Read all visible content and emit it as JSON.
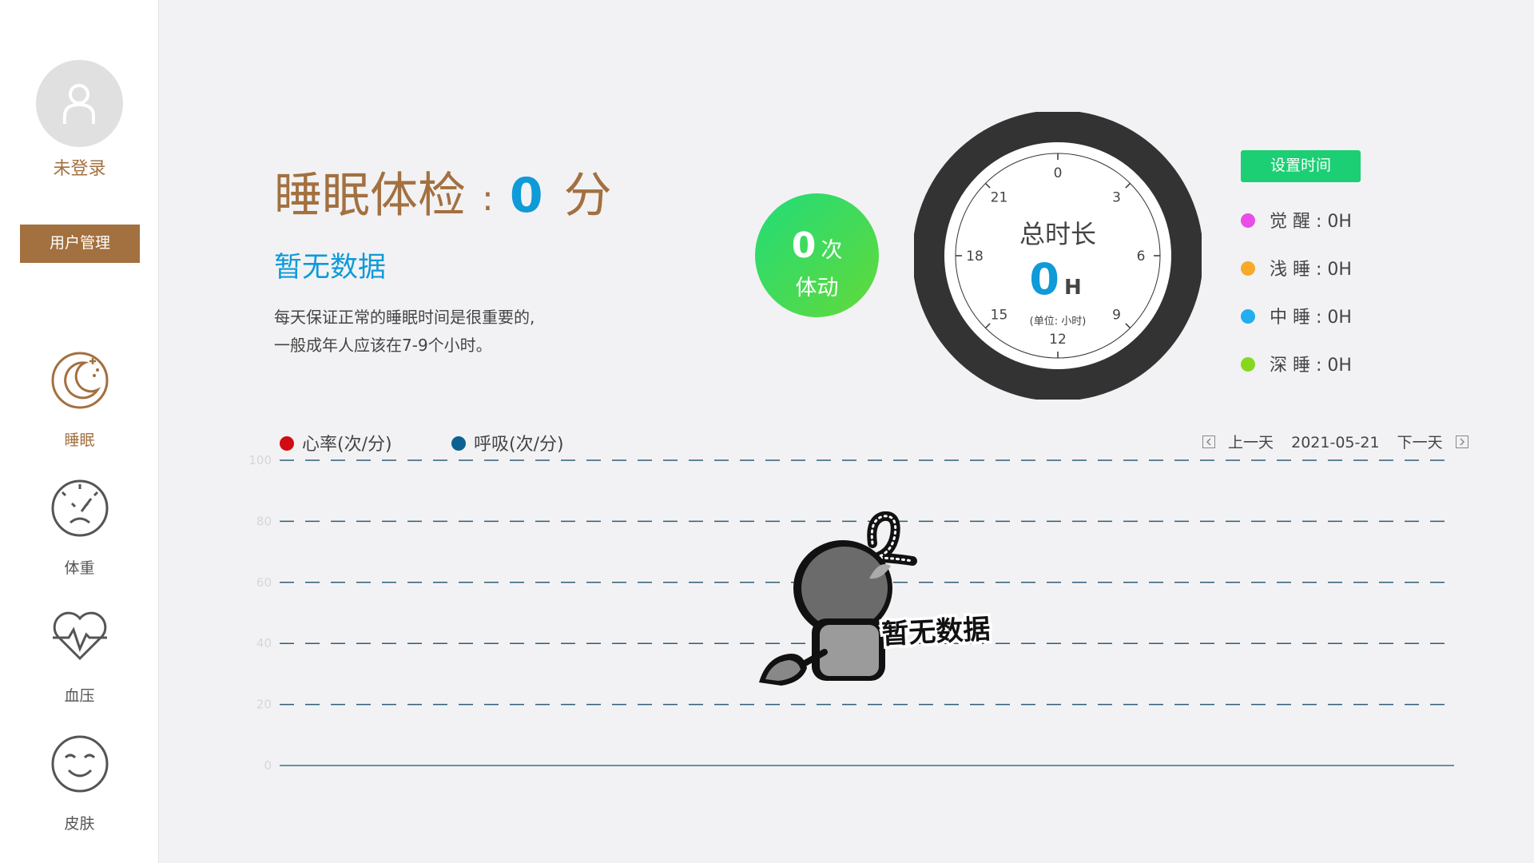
{
  "sidebar": {
    "login_status": "未登录",
    "mgmt_button": "用户管理",
    "items": [
      {
        "label": "睡眠",
        "icon": "moon-stars-icon",
        "active": true
      },
      {
        "label": "体重",
        "icon": "scale-face-icon",
        "active": false
      },
      {
        "label": "血压",
        "icon": "heart-pulse-icon",
        "active": false
      },
      {
        "label": "皮肤",
        "icon": "smile-face-icon",
        "active": false
      }
    ]
  },
  "score": {
    "title": "睡眠体检",
    "colon": ":",
    "value": "0",
    "unit": "分",
    "status": "暂无数据",
    "desc_line1": "每天保证正常的睡眠时间是很重要的,",
    "desc_line2": "一般成年人应该在7-9个小时。"
  },
  "movement": {
    "count": "0",
    "count_unit": "次",
    "label": "体动"
  },
  "dial": {
    "title": "总时长",
    "value": "0",
    "unit": "H",
    "unit_note": "(单位: 小时)",
    "hour_labels": [
      "0",
      "3",
      "6",
      "9",
      "12",
      "15",
      "18",
      "21"
    ]
  },
  "stages": {
    "set_time_button": "设置时间",
    "items": [
      {
        "name": "觉 醒",
        "value": "0H",
        "color": "#e84ee6"
      },
      {
        "name": "浅 睡",
        "value": "0H",
        "color": "#f7a928"
      },
      {
        "name": "中 睡",
        "value": "0H",
        "color": "#23aef0"
      },
      {
        "name": "深 睡",
        "value": "0H",
        "color": "#86d81f"
      }
    ]
  },
  "chart_legend": {
    "heart_rate": "心率(次/分)",
    "heart_rate_color": "#d10b14",
    "breath": "呼吸(次/分)",
    "breath_color": "#0c6191"
  },
  "date_nav": {
    "prev": "上一天",
    "date": "2021-05-21",
    "next": "下一天"
  },
  "chart_data": {
    "type": "line",
    "yticks": [
      "100",
      "80",
      "60",
      "40",
      "20",
      "0"
    ],
    "ylim": [
      0,
      100
    ],
    "series": [
      {
        "name": "心率(次/分)",
        "values": []
      },
      {
        "name": "呼吸(次/分)",
        "values": []
      }
    ]
  },
  "empty_state": {
    "text": "暂无数据"
  }
}
